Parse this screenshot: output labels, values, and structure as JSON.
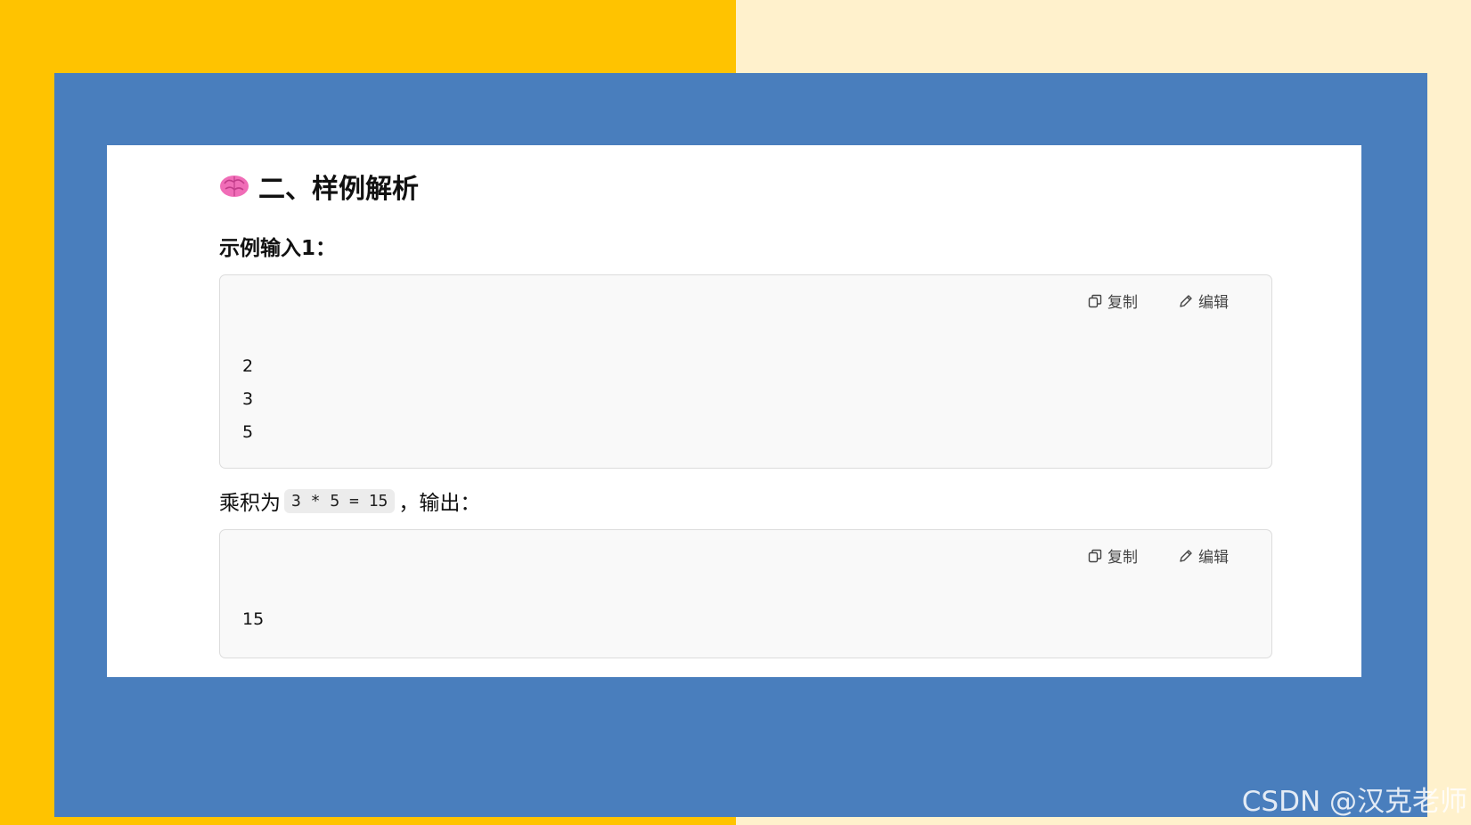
{
  "colors": {
    "bg_left": "#ffc300",
    "bg_right": "#fff1cc",
    "frame": "#497ebd",
    "card": "#ffffff"
  },
  "section": {
    "title": "二、样例解析",
    "title_icon": "brain-icon"
  },
  "sample_input": {
    "label": "示例输入1：",
    "copy_label": "复制",
    "edit_label": "编辑",
    "lines": [
      "2",
      "3",
      "5"
    ]
  },
  "explanation": {
    "prefix": "乘积为",
    "code": "3 * 5 = 15",
    "suffix": "，输出："
  },
  "sample_output": {
    "copy_label": "复制",
    "edit_label": "编辑",
    "lines": [
      "15"
    ]
  },
  "watermark": "CSDN @汉克老师"
}
